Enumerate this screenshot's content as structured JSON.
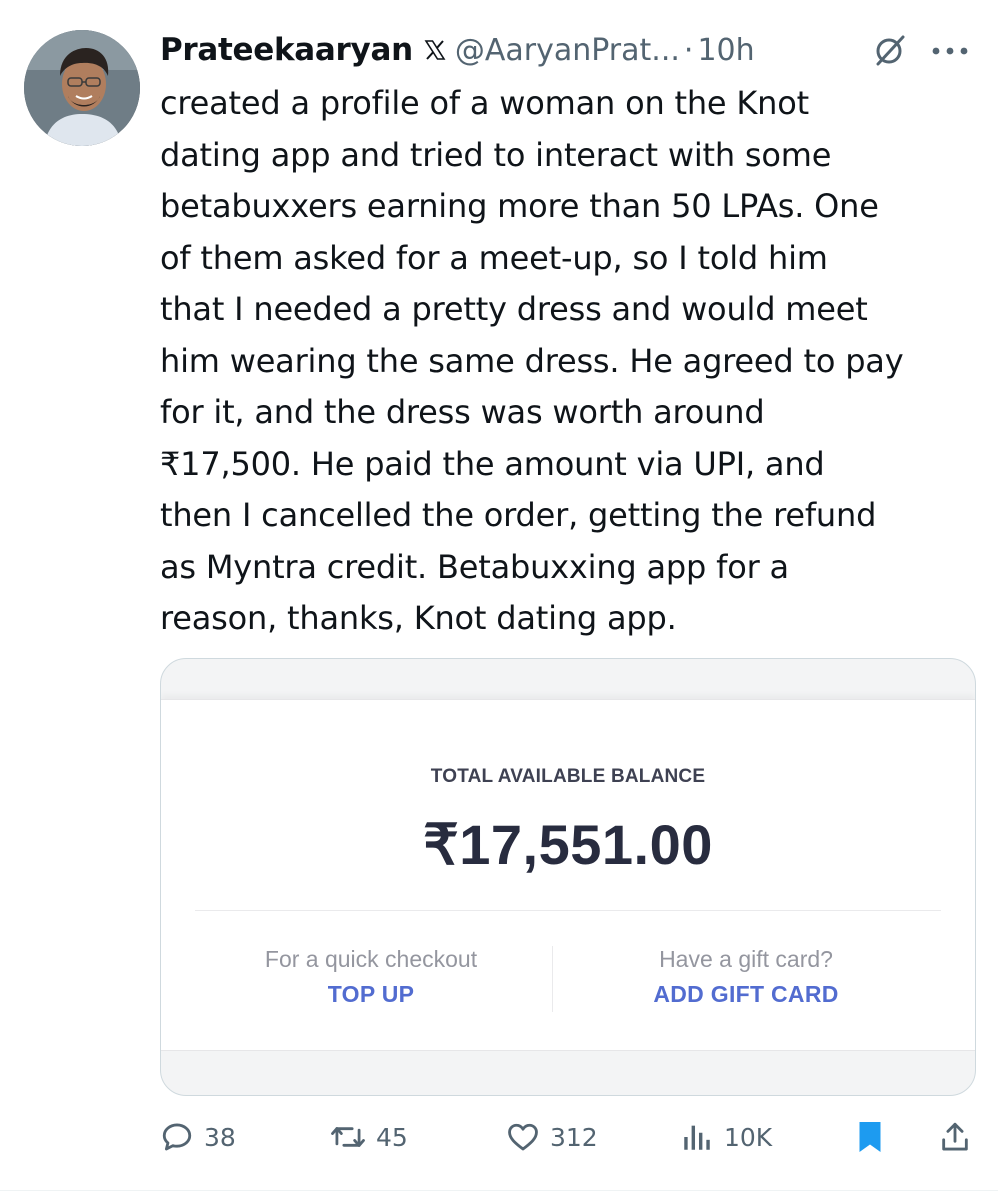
{
  "tweet": {
    "display_name": "Prateekaaryan",
    "handle": "@AaryanPrat...",
    "separator": "·",
    "time": "10h",
    "text": "created a profile of a woman on the Knot\ndating app and tried to interact with some\nbetabuxxers earning more than 50 LPAs. One\nof them asked for a meet-up, so I told him\nthat I needed a pretty dress and would meet\nhim wearing the same dress. He agreed to pay\nfor it, and the dress was worth around\n₹17,500. He paid the amount via UPI, and\nthen I cancelled the order, getting the refund\nas Myntra credit. Betabuxxing app for a\nreason, thanks, Knot dating app."
  },
  "wallet": {
    "balance_label": "TOTAL AVAILABLE BALANCE",
    "balance_amount": "₹17,551.00",
    "left_hint": "For a quick checkout",
    "left_action": "TOP UP",
    "right_hint": "Have a gift card?",
    "right_action": "ADD GIFT CARD"
  },
  "metrics": {
    "replies": "38",
    "reposts": "45",
    "likes": "312",
    "views": "10K"
  },
  "icons": {
    "verified_logo": "x-logo-icon",
    "grok": "grok-icon",
    "more": "more-icon",
    "reply": "reply-icon",
    "repost": "repost-icon",
    "like": "heart-icon",
    "views": "views-icon",
    "bookmark": "bookmark-icon",
    "share": "share-icon"
  },
  "colors": {
    "text": "#0f1419",
    "secondary": "#536471",
    "bookmark_active": "#1d9bf0",
    "wallet_action": "#526cd0",
    "wallet_amount": "#282c3f"
  }
}
